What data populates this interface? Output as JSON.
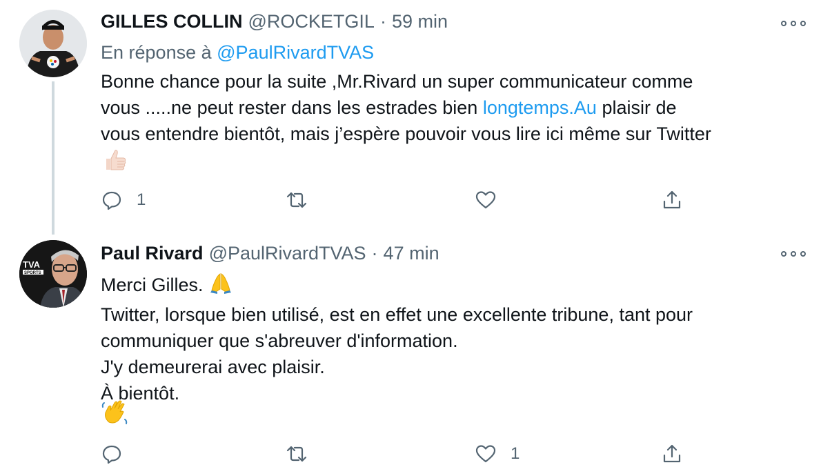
{
  "tweets": [
    {
      "author_name": "GILLES COLLIN",
      "handle": "@ROCKETGIL",
      "separator": "·",
      "time": "59 min",
      "reply_prefix": "En réponse à",
      "reply_mention": "@PaulRivardTVAS",
      "text_line1": "Bonne chance pour la suite ,Mr.Rivard un super communicateur comme",
      "text_line2_a": "vous .....ne peut rester dans les estrades bien ",
      "text_line2_link": "longtemps.Au",
      "text_line2_b": " plaisir de",
      "text_line3": "vous entendre bientôt, mais j’espère pouvoir vous lire ici même sur Twitter",
      "emoji": "thumbs-up-icon",
      "actions": {
        "reply_count": "1",
        "retweet_count": "",
        "like_count": ""
      }
    },
    {
      "author_name": "Paul Rivard",
      "handle": "@PaulRivardTVAS",
      "separator": "·",
      "time": "47 min",
      "avatar_badge": "TVA",
      "avatar_badge_sub": "SPORTS",
      "text_line1": "Merci Gilles.",
      "text_line1_emoji": "folded-hands-icon",
      "text_line2": "Twitter, lorsque bien utilisé, est en effet une excellente tribune, tant pour",
      "text_line3": "communiquer que s'abreuver d'information.",
      "text_line4": "J'y demeurerai avec plaisir.",
      "text_line5": "À bientôt.",
      "emoji": "waving-hand-icon",
      "actions": {
        "reply_count": "",
        "retweet_count": "",
        "like_count": "1"
      }
    }
  ],
  "colors": {
    "text": "#0f1419",
    "secondary": "#536471",
    "link": "#1d9bf0",
    "thread_line": "#cfd9de"
  }
}
